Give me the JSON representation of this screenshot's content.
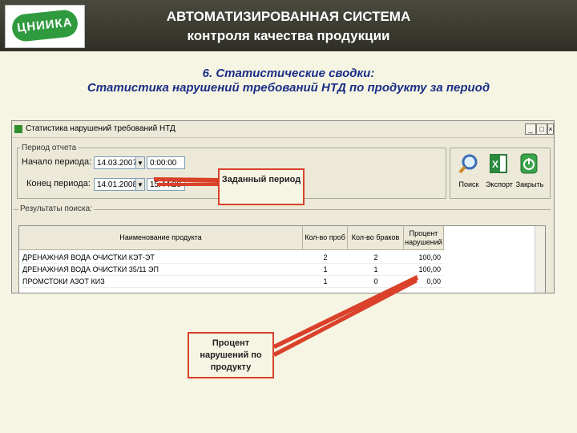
{
  "header": {
    "logo_text": "ЦНИИКА",
    "title": "АВТОМАТИЗИРОВАННАЯ  СИСТЕМА",
    "subtitle": "контроля качества продукции"
  },
  "section": {
    "heading": "6. Статистические сводки:",
    "subheading": "Статистика нарушений требований НТД по продукту за период"
  },
  "window": {
    "title": "Статистика нарушений требований НТД",
    "controls": [
      "_",
      "□",
      "×"
    ],
    "period_group_label": "Период отчета",
    "start_label": "Начало периода:",
    "start_date": "14.03.2007",
    "start_time": "0:00:00",
    "end_label": "Конец периода:",
    "end_date": "14.01.2008",
    "end_time": "15:44:20",
    "toolbar": [
      {
        "label": "Поиск",
        "icon": "magnifier-icon"
      },
      {
        "label": "Экспорт",
        "icon": "excel-icon"
      },
      {
        "label": "Закрыть",
        "icon": "power-icon"
      }
    ],
    "results_label": "Результаты поиска:",
    "table": {
      "columns": [
        "Наименование продукта",
        "Кол-во проб",
        "Кол-во браков",
        "Процент нарушений"
      ],
      "rows": [
        [
          "ДРЕНАЖНАЯ ВОДА ОЧИСТКИ КЭТ-ЭТ",
          "2",
          "2",
          "100,00"
        ],
        [
          "ДРЕНАЖНАЯ ВОДА ОЧИСТКИ 35/11 ЭП",
          "1",
          "1",
          "100,00"
        ],
        [
          "ПРОМСТОКИ АЗОТ КИЗ",
          "1",
          "0",
          "0,00"
        ]
      ]
    }
  },
  "callouts": {
    "period": "Заданный период",
    "percent": "Процент нарушений по продукту"
  },
  "colors": {
    "accent_text": "#1b2f86",
    "callout_border": "#d9412a",
    "logo_green": "#2f9a3e"
  }
}
